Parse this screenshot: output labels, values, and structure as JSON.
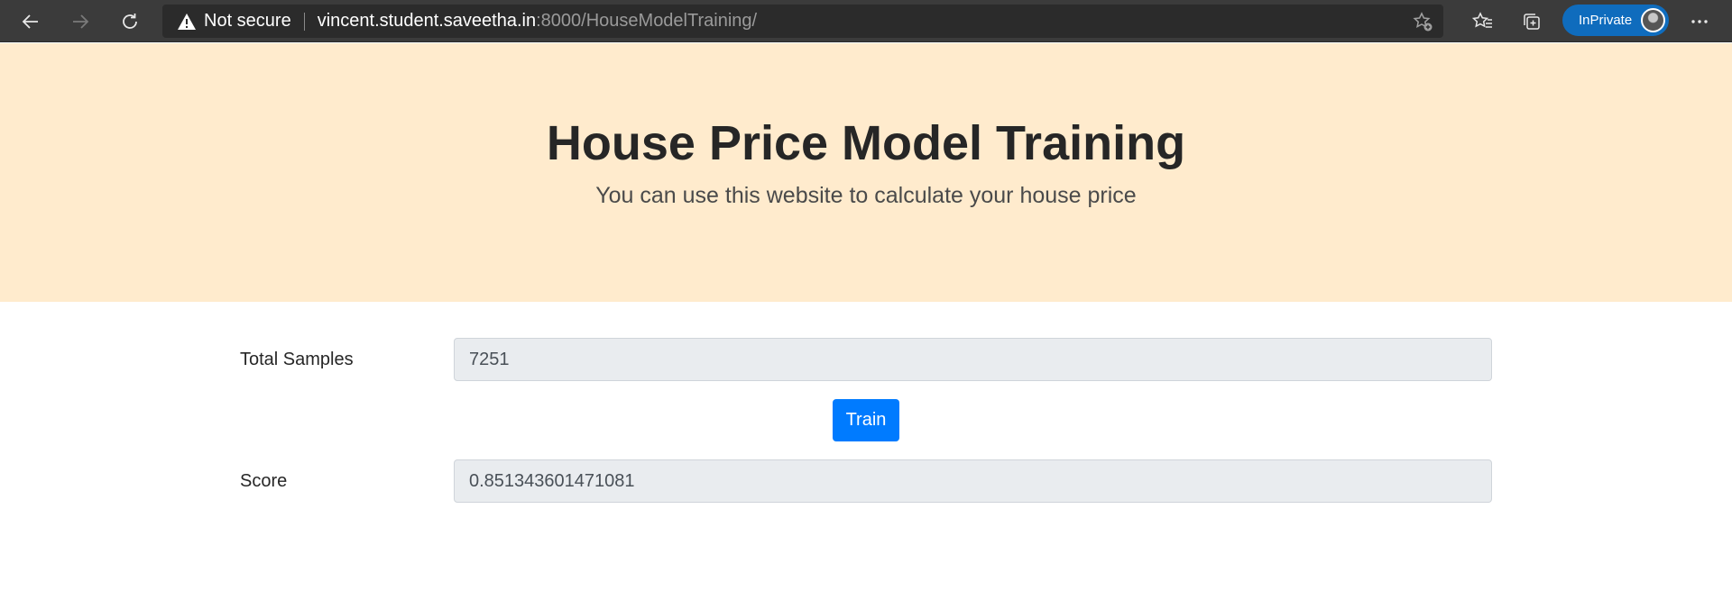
{
  "browser": {
    "security_text": "Not secure",
    "url_host": "vincent.student.saveetha.in",
    "url_path": ":8000/HouseModelTraining/",
    "inprivate_label": "InPrivate",
    "icons": [
      "back-icon",
      "forward-icon",
      "refresh-icon",
      "warning-icon",
      "add-favorite-icon",
      "favorites-icon",
      "collections-icon",
      "more-icon"
    ],
    "accent": "#0f6cbd"
  },
  "hero": {
    "title": "House Price Model Training",
    "subtitle": "You can use this website to calculate your house price",
    "background": "#ffebcd"
  },
  "form": {
    "total_samples_label": "Total Samples",
    "total_samples_value": "7251",
    "train_label": "Train",
    "score_label": "Score",
    "score_value": "0.851343601471081",
    "button_color": "#007bff"
  }
}
